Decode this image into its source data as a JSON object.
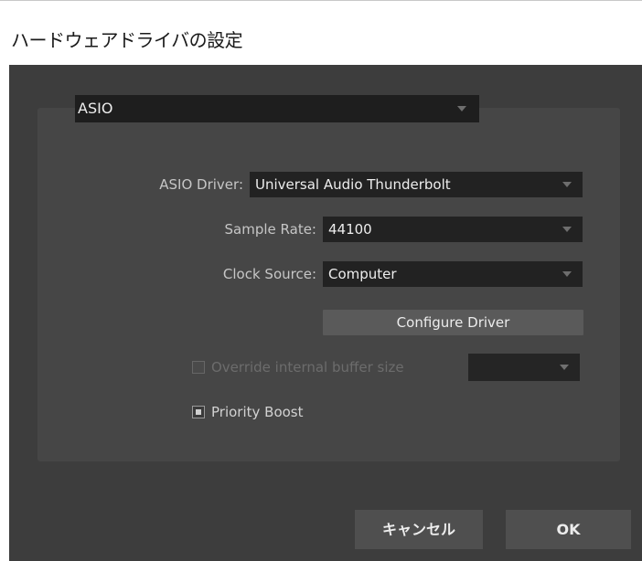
{
  "window": {
    "title": "ハードウェアドライバの設定"
  },
  "driver_type": {
    "selected": "ASIO",
    "icon": "chevron-down-icon"
  },
  "asio_driver": {
    "label": "ASIO Driver:",
    "selected": "Universal Audio Thunderbolt"
  },
  "sample_rate": {
    "label": "Sample Rate:",
    "selected": "44100"
  },
  "clock_source": {
    "label": "Clock Source:",
    "selected": "Computer"
  },
  "configure_driver": {
    "label": "Configure Driver"
  },
  "override_buffer": {
    "label": "Override internal buffer size",
    "checked": false,
    "disabled": true,
    "selected": ""
  },
  "priority_boost": {
    "label": "Priority Boost",
    "checked": true
  },
  "footer": {
    "cancel_label": "キャンセル",
    "ok_label": "OK"
  },
  "colors": {
    "dialog_background": "#3d3d3d",
    "panel_background": "#464646",
    "select_background": "#222222",
    "button_background": "#5a5a5a",
    "text_primary": "#ededed",
    "text_secondary": "#c6c6c6",
    "text_disabled": "#6c6c6c"
  }
}
